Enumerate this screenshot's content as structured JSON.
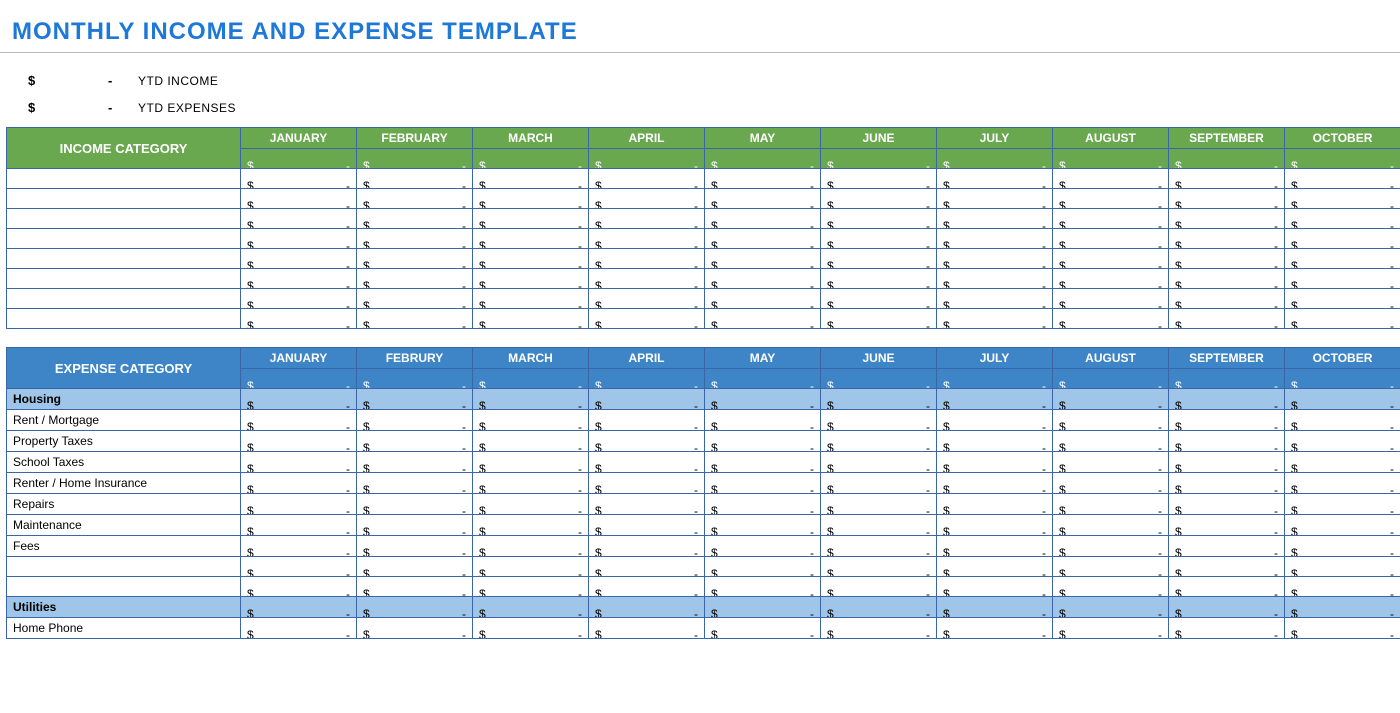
{
  "title": "MONTHLY INCOME AND EXPENSE TEMPLATE",
  "ytd": {
    "currency": "$",
    "dash": "-",
    "income_label": "YTD INCOME",
    "expenses_label": "YTD EXPENSES"
  },
  "symbols": {
    "dollar": "$",
    "dash": "-"
  },
  "income": {
    "category_header": "INCOME CATEGORY",
    "months": [
      "JANUARY",
      "FEBRUARY",
      "MARCH",
      "APRIL",
      "MAY",
      "JUNE",
      "JULY",
      "AUGUST",
      "SEPTEMBER",
      "OCTOBER"
    ],
    "rows": 8
  },
  "expense": {
    "category_header": "EXPENSE CATEGORY",
    "months": [
      "JANUARY",
      "FEBRURY",
      "MARCH",
      "APRIL",
      "MAY",
      "JUNE",
      "JULY",
      "AUGUST",
      "SEPTEMBER",
      "OCTOBER"
    ],
    "groups": [
      {
        "name": "Housing",
        "items": [
          "Rent / Mortgage",
          "Property Taxes",
          "School Taxes",
          "Renter / Home Insurance",
          "Repairs",
          "Maintenance",
          "Fees",
          "",
          ""
        ]
      },
      {
        "name": "Utilities",
        "items": [
          "Home Phone"
        ]
      }
    ]
  }
}
